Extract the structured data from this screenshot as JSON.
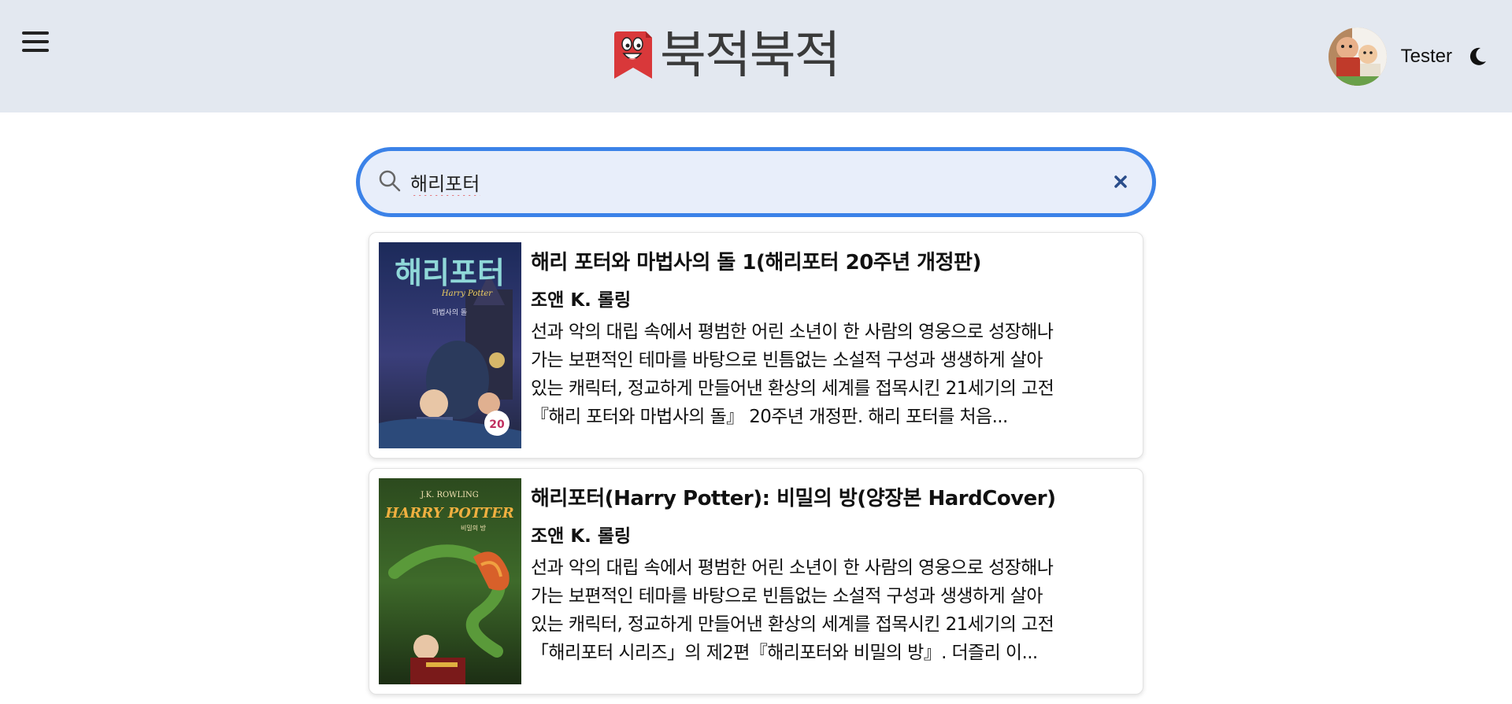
{
  "app": {
    "logo_text": "북적북적",
    "username": "Tester"
  },
  "search": {
    "value": "해리포터",
    "placeholder": ""
  },
  "results": [
    {
      "title": "해리 포터와 마법사의 돌 1(해리포터 20주년 개정판)",
      "author": "조앤 K. 롤링",
      "description": "선과 악의 대립 속에서 평범한 어린 소년이 한 사람의 영웅으로 성장해나\n가는 보편적인 테마를 바탕으로 빈틈없는 소설적 구성과 생생하게 살아\n있는 캐릭터, 정교하게 만들어낸 환상의 세계를 접목시킨 21세기의 고전\n『해리 포터와 마법사의 돌』 20주년 개정판. 해리 포터를 처음...",
      "cover_title": "해리포터",
      "cover_sub": "Harry Potter",
      "cover_vol": "마법사의 돌",
      "cover_badge": "20"
    },
    {
      "title": "해리포터(Harry Potter): 비밀의 방(양장본 HardCover)",
      "author": "조앤 K. 롤링",
      "description": "선과 악의 대립 속에서 평범한 어린 소년이 한 사람의 영웅으로 성장해나\n가는 보편적인 테마를 바탕으로 빈틈없는 소설적 구성과 생생하게 살아\n있는 캐릭터, 정교하게 만들어낸 환상의 세계를 접목시킨 21세기의 고전\n「해리포터 시리즈」의 제2편『해리포터와 비밀의 방』. 더즐리 이...",
      "cover_author": "J.K. ROWLING",
      "cover_title": "HARRY POTTER",
      "cover_sub": "비밀의 방"
    }
  ],
  "colors": {
    "header_bg": "#e3e8f0",
    "search_border": "#3b82e8",
    "search_bg": "#e8eefa",
    "logo_red": "#d9383a"
  },
  "icons": {
    "menu": "hamburger-menu-icon",
    "search": "search-icon",
    "clear": "close-icon",
    "theme": "moon-icon"
  }
}
